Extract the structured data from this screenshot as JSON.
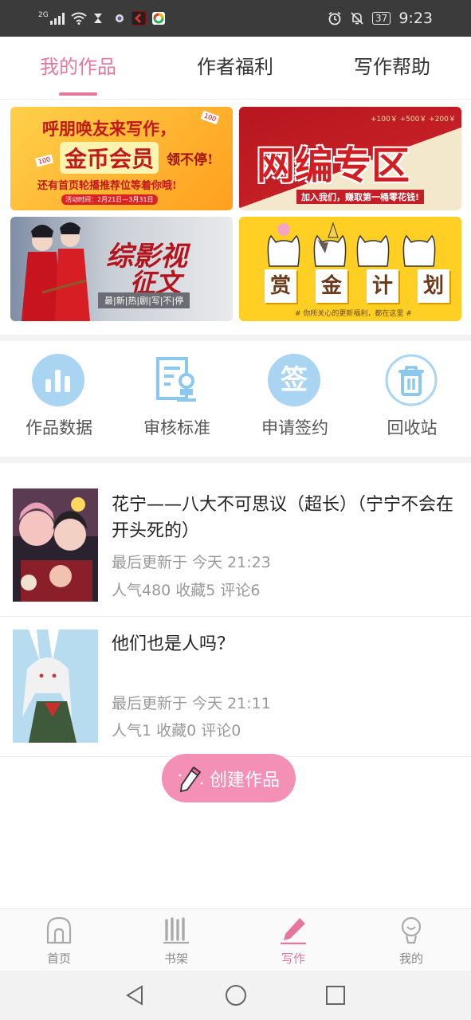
{
  "status_bar": {
    "network_label": "2G",
    "time": "9:23",
    "battery": "37",
    "icons": [
      "signal-icon",
      "wifi-icon",
      "hourglass-icon",
      "app-icon",
      "app-icon",
      "app-icon",
      "alarm-icon",
      "mute-icon",
      "battery-icon"
    ]
  },
  "tabs": [
    {
      "label": "我的作品",
      "active": true
    },
    {
      "label": "作者福利",
      "active": false
    },
    {
      "label": "写作帮助",
      "active": false
    }
  ],
  "banners": {
    "b1_line1": "呼朋唤友来写作，",
    "b1_line2": "金币会员",
    "b1_line2b": "领不停!",
    "b1_line3": "还有首页轮播推荐位等着你哦!",
    "b1_date": "活动时间：2月21日—3月31日",
    "b1_tag": "100",
    "b2_title": "网编专区",
    "b2_sub": "加入我们，赚取第一桶零花钱!",
    "b2_prices": "+100￥  +500￥  +200￥",
    "b3_title1": "综影视",
    "b3_title2": "征文",
    "b3_sub": "最|新|热|剧|写|不|停",
    "b4_chars": [
      "赏",
      "金",
      "计",
      "划"
    ],
    "b4_sub": "# 你所关心的更新福利，都在这里 #"
  },
  "quick_actions": [
    {
      "label": "作品数据",
      "icon": "bar-chart-icon"
    },
    {
      "label": "审核标准",
      "icon": "document-stamp-icon"
    },
    {
      "label": "申请签约",
      "icon": "sign-icon",
      "icon_text": "签"
    },
    {
      "label": "回收站",
      "icon": "trash-icon"
    }
  ],
  "works": [
    {
      "title": "花宁——八大不可思议（超长）（宁宁不会在开头死的）",
      "updated": "最后更新于 今天 21:23",
      "stats": "人气480  收藏5  评论6"
    },
    {
      "title": "他们也是人吗？",
      "updated": "最后更新于 今天 21:11",
      "stats": "人气1  收藏0  评论0"
    }
  ],
  "create_button": "创建作品",
  "bottom_nav": [
    {
      "label": "首页",
      "icon": "home-icon",
      "active": false
    },
    {
      "label": "书架",
      "icon": "bookshelf-icon",
      "active": false
    },
    {
      "label": "写作",
      "icon": "pen-icon",
      "active": true
    },
    {
      "label": "我的",
      "icon": "profile-icon",
      "active": false
    }
  ],
  "colors": {
    "accent": "#e5779d",
    "fab": "#f48fb6",
    "icon_blue": "#8cc8ee"
  }
}
